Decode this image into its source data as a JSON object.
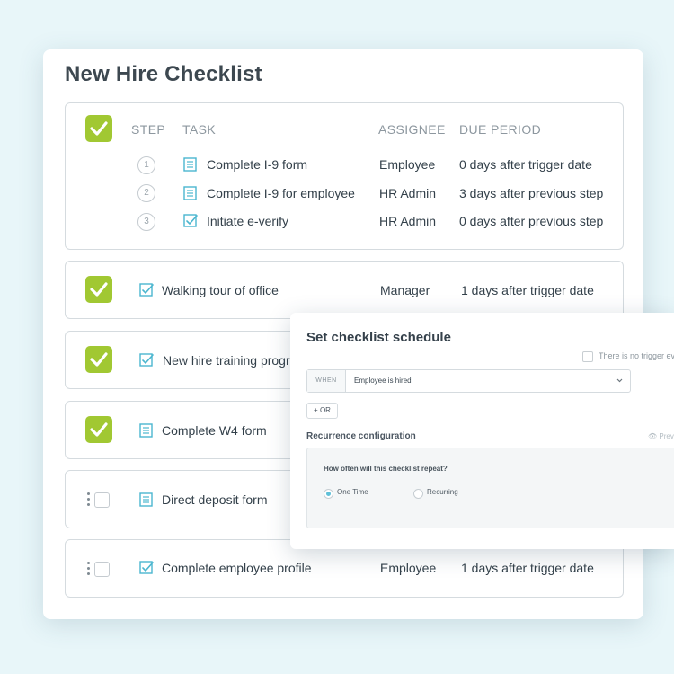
{
  "checklist": {
    "title": "New  Hire Checklist",
    "headers": {
      "step": "STEP",
      "task": "TASK",
      "assignee": "ASSIGNEE",
      "due": "DUE PERIOD"
    },
    "group": {
      "checked": true,
      "steps": [
        {
          "num": "1",
          "task": "Complete I-9 form",
          "assignee": "Employee",
          "due": "0 days after trigger date",
          "icon": "document-icon"
        },
        {
          "num": "2",
          "task": "Complete I-9 for employee",
          "assignee": "HR Admin",
          "due": "3 days after previous step",
          "icon": "document-icon"
        },
        {
          "num": "3",
          "task": "Initiate e-verify",
          "assignee": "HR Admin",
          "due": "0 days after previous step",
          "icon": "checkbox-task-icon"
        }
      ]
    },
    "items": [
      {
        "task": "Walking tour of office",
        "assignee": "Manager",
        "due": "1 days after trigger date",
        "checked": true,
        "icon": "checkbox-task-icon"
      },
      {
        "task": "New hire training progr",
        "assignee": "",
        "due": "",
        "checked": true,
        "icon": "checkbox-task-icon"
      },
      {
        "task": "Complete W4 form",
        "assignee": "",
        "due": "",
        "checked": true,
        "icon": "document-icon"
      },
      {
        "task": "Direct deposit form",
        "assignee": "",
        "due": "",
        "checked": false,
        "icon": "document-icon"
      },
      {
        "task": "Complete employee profile",
        "assignee": "Employee",
        "due": "1 days after trigger date",
        "checked": false,
        "icon": "checkbox-task-icon"
      }
    ]
  },
  "schedule_modal": {
    "title": "Set checklist schedule",
    "no_trigger_label": "There is no trigger ev",
    "when_label": "WHEN",
    "when_value": "Employee is hired",
    "or_button": "+ OR",
    "recurrence_title": "Recurrence configuration",
    "preview_label": "Prev",
    "question": "How often will this checklist repeat?",
    "options": [
      {
        "label": "One Time",
        "selected": true
      },
      {
        "label": "Recurring",
        "selected": false
      }
    ]
  },
  "colors": {
    "check_green": "#a1c832",
    "icon_teal": "#4bb6cf",
    "background": "#e8f6f9"
  }
}
